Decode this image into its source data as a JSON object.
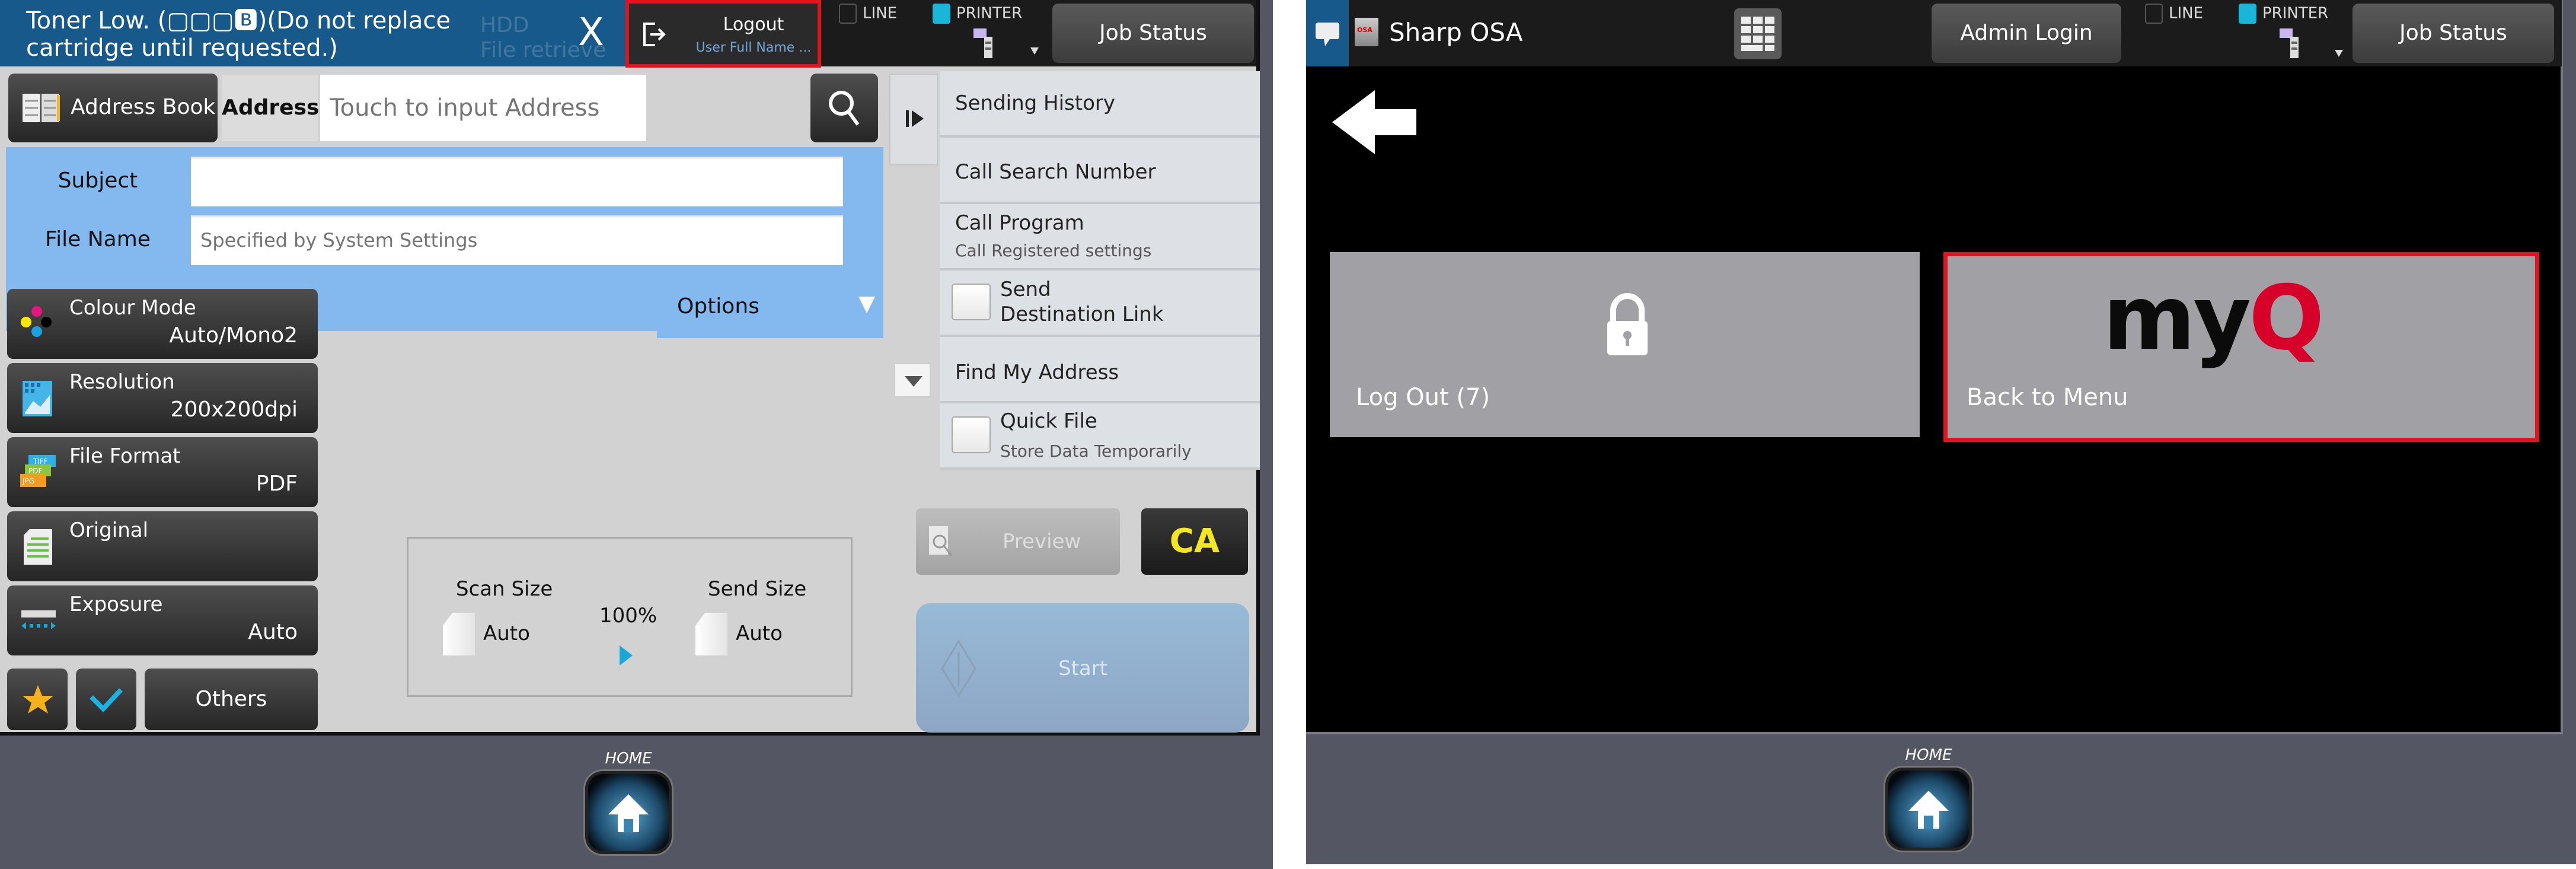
{
  "left_screen": {
    "header": {
      "notification": "Toner Low. (▢▢▢Bk)(Do not replace cartridge until requested.)",
      "notification_line1": "Toner Low. (▢▢▢🅱︎)(Do not replace",
      "notification_line2": "cartridge until requested.)",
      "background_item_label1": "HDD",
      "background_item_label2": "File retrieve",
      "close_glyph": "X",
      "logout_label": "Logout",
      "logout_user": "User Full Name ...",
      "line_indicator": "LINE",
      "printer_indicator": "PRINTER",
      "job_status_label": "Job Status"
    },
    "address": {
      "address_book_label": "Address Book",
      "address_label": "Address",
      "address_placeholder": "Touch to input Address"
    },
    "fields": {
      "subject_label": "Subject",
      "subject_value": "",
      "file_name_label": "File Name",
      "file_name_placeholder": "Specified by System Settings",
      "options_label": "Options"
    },
    "menu": [
      {
        "title": "Sending History"
      },
      {
        "title": "Call Search Number"
      },
      {
        "title": "Call Program",
        "subtitle": "Call Registered settings"
      },
      {
        "title": "Send",
        "title2": "Destination Link",
        "checkbox": false
      },
      {
        "title": "Find My Address"
      },
      {
        "title": "Quick File",
        "subtitle": "Store Data Temporarily",
        "checkbox": false
      }
    ],
    "functions": [
      {
        "title": "Colour Mode",
        "value": "Auto/Mono2",
        "icon": "colour-mode-icon"
      },
      {
        "title": "Resolution",
        "value": "200x200dpi",
        "icon": "resolution-icon"
      },
      {
        "title": "File Format",
        "value": "PDF",
        "icon": "file-format-icon"
      },
      {
        "title": "Original",
        "value": "",
        "icon": "original-icon"
      },
      {
        "title": "Exposure",
        "value": "Auto",
        "icon": "exposure-icon"
      }
    ],
    "others_label": "Others",
    "file_format_icon_labels": [
      "TIFF",
      "PDF",
      "JPG"
    ],
    "size": {
      "scan_size_label": "Scan Size",
      "scan_size_value": "Auto",
      "ratio": "100%",
      "send_size_label": "Send Size",
      "send_size_value": "Auto"
    },
    "preview_label": "Preview",
    "ca_label": "CA",
    "start_label": "Start",
    "home_label": "HOME"
  },
  "right_screen": {
    "header": {
      "app_title": "Sharp OSA",
      "admin_login_label": "Admin Login",
      "line_indicator": "LINE",
      "printer_indicator": "PRINTER",
      "job_status_label": "Job Status"
    },
    "tiles": [
      {
        "label": "Log Out (7)",
        "icon": "lock-icon"
      },
      {
        "label": "Back to Menu",
        "logo_text_dark": "my",
        "logo_text_accent": "Q",
        "highlighted": true
      }
    ],
    "home_label": "HOME"
  },
  "colors": {
    "header_blue": "#17598a",
    "highlight_red": "#e0141e",
    "form_blue": "#84b9ef",
    "ca_yellow": "#f3e624",
    "myq_red": "#d6002a",
    "printer_cyan": "#19b6d9"
  }
}
